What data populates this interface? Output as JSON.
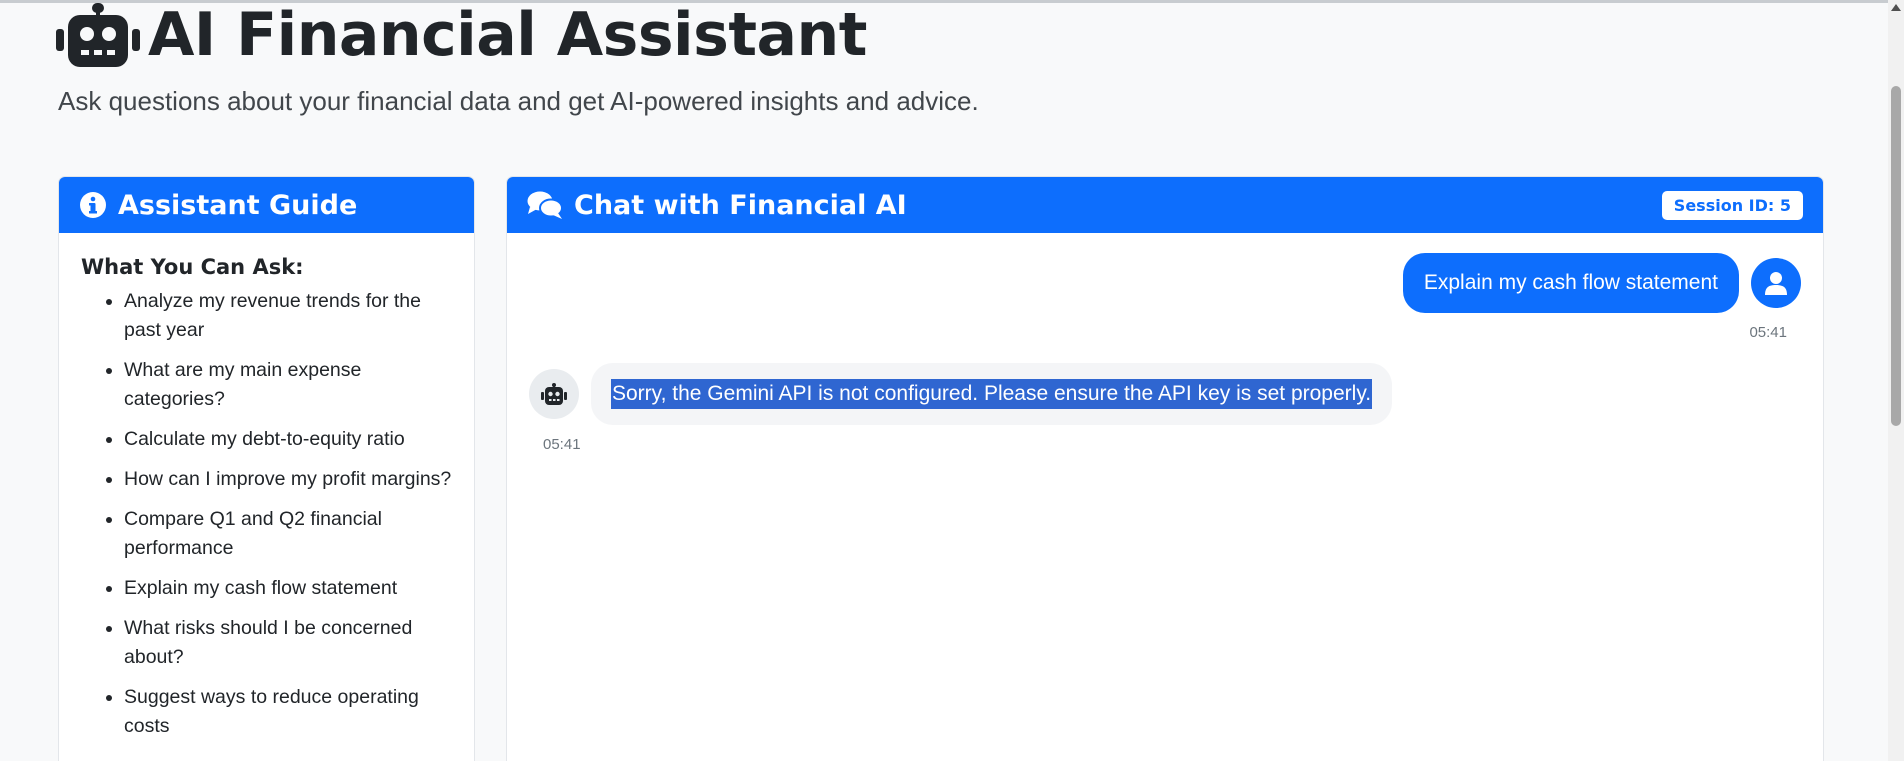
{
  "header": {
    "title": "AI Financial Assistant",
    "subtitle": "Ask questions about your financial data and get AI-powered insights and advice."
  },
  "guide": {
    "title": "Assistant Guide",
    "heading": "What You Can Ask:",
    "items": [
      "Analyze my revenue trends for the past year",
      "What are my main expense categories?",
      "Calculate my debt-to-equity ratio",
      "How can I improve my profit margins?",
      "Compare Q1 and Q2 financial performance",
      "Explain my cash flow statement",
      "What risks should I be concerned about?",
      "Suggest ways to reduce operating costs"
    ]
  },
  "chat": {
    "title": "Chat with Financial AI",
    "session_label": "Session ID: 5",
    "messages": [
      {
        "role": "user",
        "text": "Explain my cash flow statement",
        "time": "05:41"
      },
      {
        "role": "bot",
        "text": "Sorry, the Gemini API is not configured. Please ensure the API key is set properly.",
        "time": "05:41"
      }
    ]
  },
  "colors": {
    "primary": "#0d6efd",
    "selection": "#2f66d1",
    "background": "#f8f9fa"
  }
}
